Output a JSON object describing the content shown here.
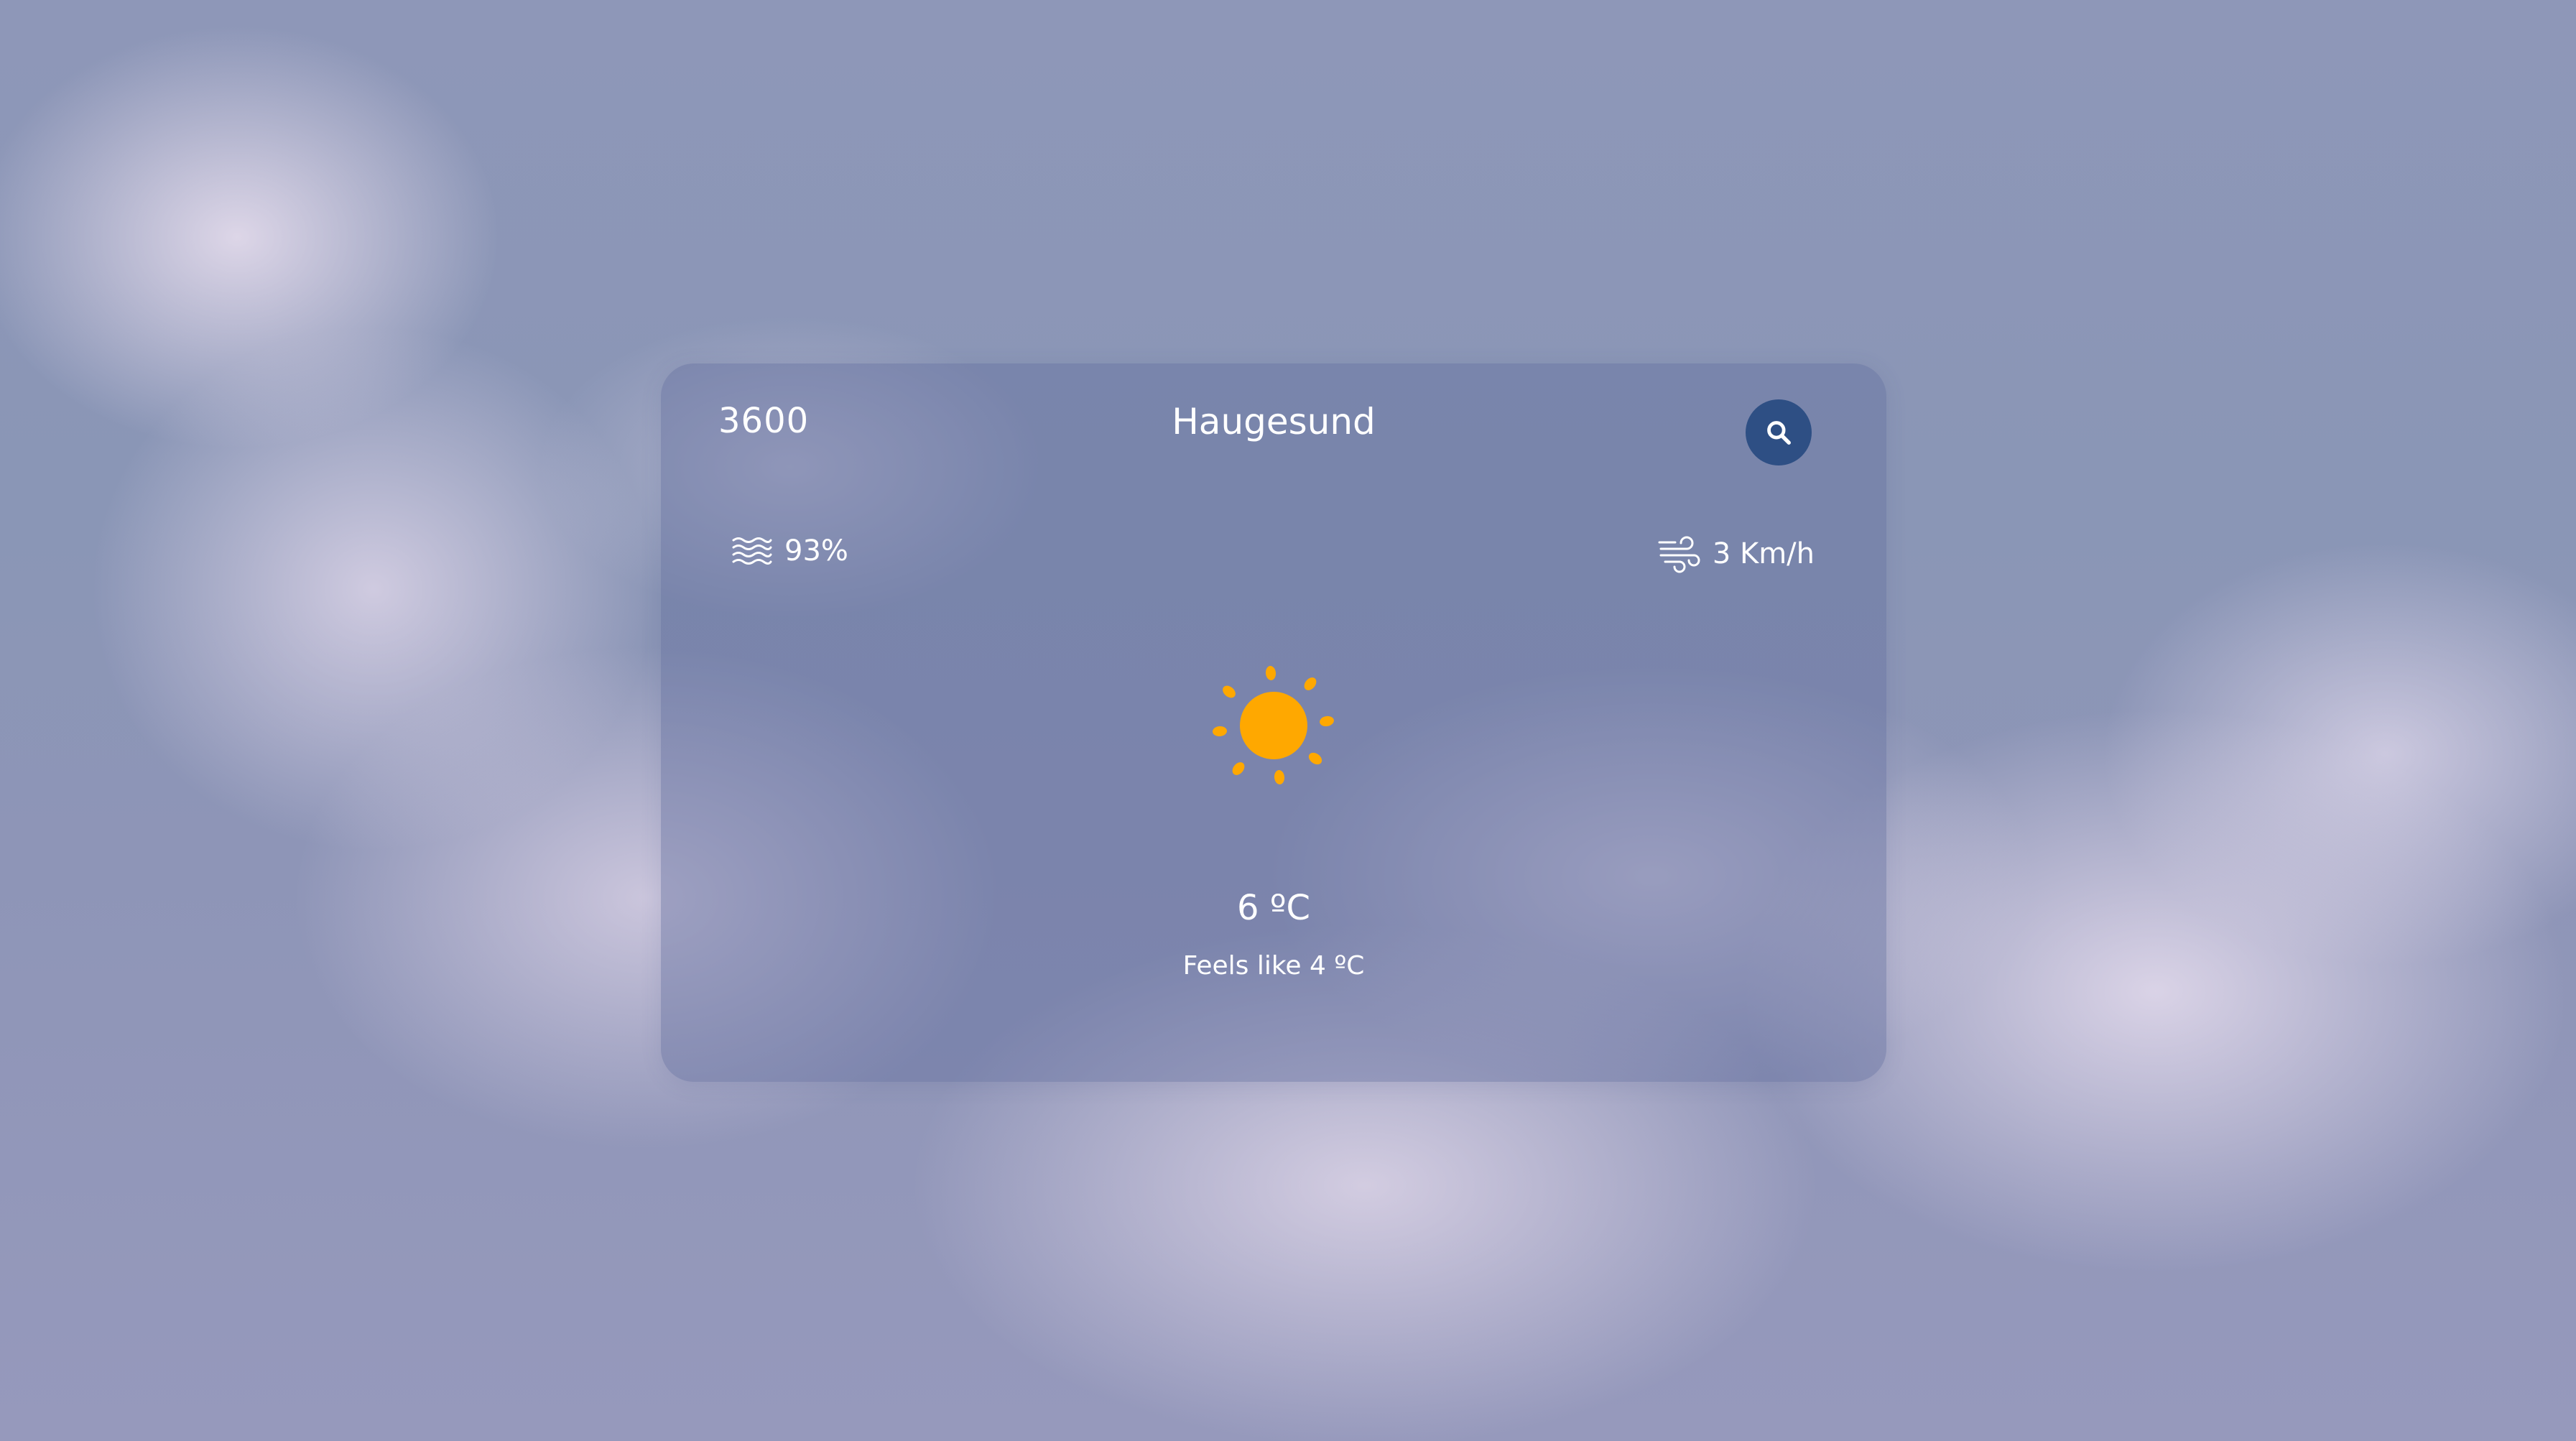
{
  "weather": {
    "zip": "3600",
    "city": "Haugesund",
    "humidity": "93%",
    "wind": "3 Km/h",
    "temperature": "6 ºC",
    "feels_like": "Feels like 4 ºC",
    "condition_icon": "sun-icon"
  },
  "icons": {
    "search": "search-icon",
    "humidity": "humidity-waves-icon",
    "wind": "wind-icon"
  },
  "colors": {
    "card_background": "#626e9e",
    "search_button": "#2e4f84",
    "sun": "#ffa800",
    "text": "#ffffff"
  }
}
